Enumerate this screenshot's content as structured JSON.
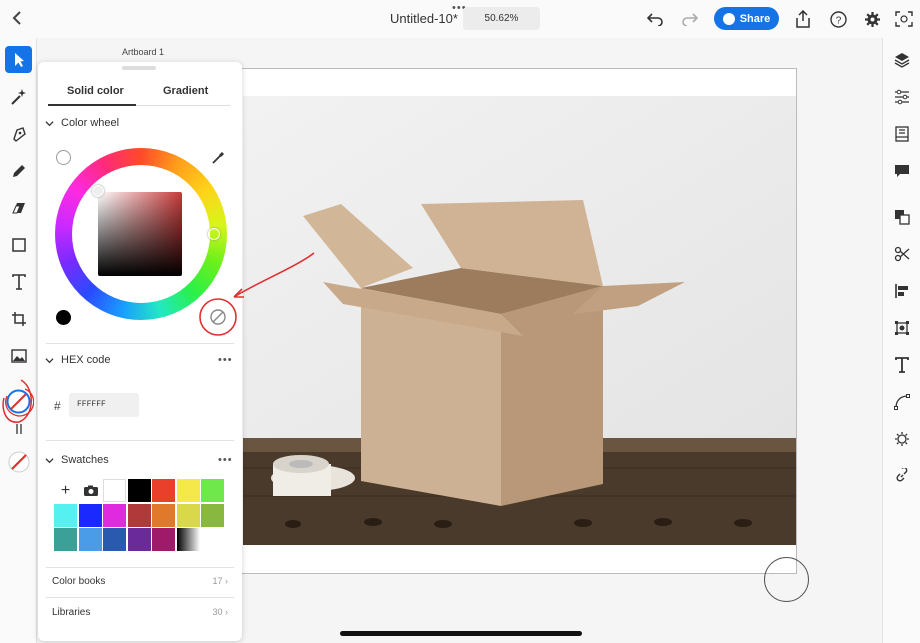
{
  "topbar": {
    "title": "Untitled-10*",
    "zoom": "50.62%",
    "share_label": "Share"
  },
  "artboard": {
    "label": "Artboard 1"
  },
  "panel": {
    "tabs": [
      "Solid color",
      "Gradient"
    ],
    "color_wheel_label": "Color wheel",
    "hex_label": "HEX code",
    "hex_value": "FFFFFF",
    "hex_hash": "#",
    "swatches_label": "Swatches",
    "swatch_colors": [
      [
        "#ffffff",
        "#000000",
        "#e8402a",
        "#f5e84a",
        "#6ee84a"
      ],
      [
        "#55f0f0",
        "#1a2aff",
        "#e02ae0",
        "#b03a3a",
        "#e07a2a",
        "#d8d84a",
        "#88b840"
      ],
      [
        "#3aa098",
        "#4a9ce8",
        "#2a5ab0",
        "#6a2a9a",
        "#a01a6a"
      ]
    ],
    "color_books_label": "Color books",
    "color_books_count": "17",
    "libraries_label": "Libraries",
    "libraries_count": "30"
  },
  "colors": {
    "accent": "#1473e6",
    "annotation": "#e03030"
  }
}
